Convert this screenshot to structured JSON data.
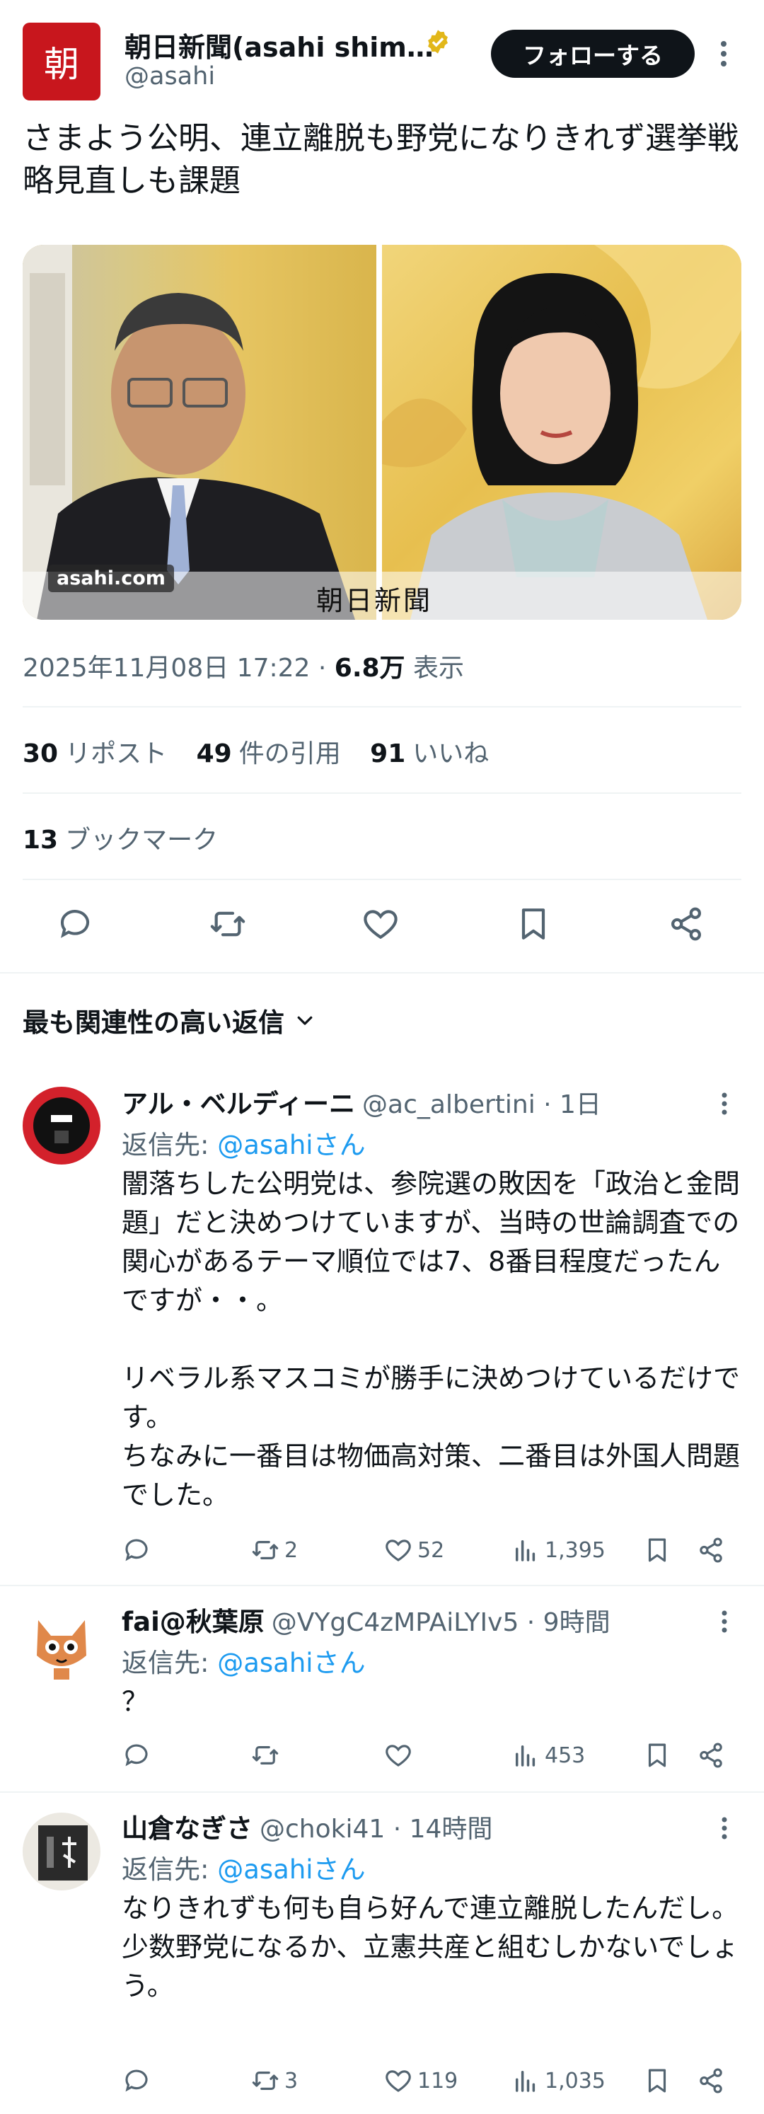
{
  "account": {
    "logo_char": "朝",
    "name": "朝日新聞(asahi shim…",
    "handle": "@asahi",
    "follow_label": "フォローする"
  },
  "tweet": {
    "text": "さまよう公明、連立離脱も野党になりきれず選挙戦略見直しも課題",
    "watermark_site": "asahi.com",
    "watermark_paper": "朝日新聞",
    "date": "2025年11月08日 17:22 · ",
    "views_count": "6.8万",
    "views_label": " 表示"
  },
  "stats": {
    "reposts_count": "30",
    "reposts_label": "リポスト",
    "quotes_count": "49",
    "quotes_label": "件の引用",
    "likes_count": "91",
    "likes_label": "いいね",
    "bookmarks_count": "13",
    "bookmarks_label": "ブックマーク"
  },
  "sort_label": "最も関連性の高い返信",
  "replies": [
    {
      "name": "アル・ベルディーニ",
      "handle_time": "@ac_albertini · 1日",
      "reply_to_prefix": "返信先: ",
      "reply_to": "@asahiさん",
      "body": "闇落ちした公明党は、参院選の敗因を「政治と金問題」だと決めつけていますが、当時の世論調査での関心があるテーマ順位では7、8番目程度だったんですが・・。\n\nリベラル系マスコミが勝手に決めつけているだけです。\nちなみに一番目は物価高対策、二番目は外国人問題でした。",
      "retweets": "2",
      "likes": "52",
      "views": "1,395"
    },
    {
      "name": "fai@秋葉原",
      "handle_time": "@VYgC4zMPAiLYIv5 · 9時間",
      "reply_to_prefix": "返信先: ",
      "reply_to": "@asahiさん",
      "body": "？",
      "retweets": "",
      "likes": "",
      "views": "453"
    },
    {
      "name": "山倉なぎさ",
      "handle_time": "@choki41 · 14時間",
      "reply_to_prefix": "返信先: ",
      "reply_to": "@asahiさん",
      "body": "なりきれずも何も自ら好んで連立離脱したんだし。\n少数野党になるか、立憲共産と組むしかないでしょう。",
      "retweets": "3",
      "likes": "119",
      "views": "1,035"
    }
  ],
  "colors": {
    "accent": "#1d9bf0",
    "brand": "#c8161d",
    "text": "#0f1419",
    "muted": "#536471"
  }
}
